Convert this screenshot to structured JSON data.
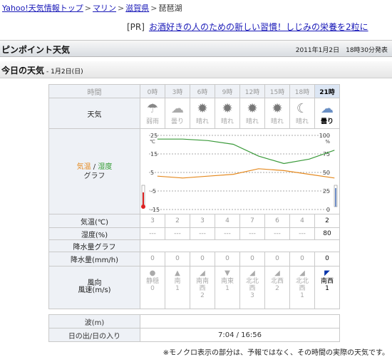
{
  "breadcrumb": {
    "items": [
      "Yahoo!天気情報トップ",
      "マリン",
      "滋賀県"
    ],
    "current": "琵琶湖",
    "separator": ">"
  },
  "ad": {
    "tag": "[PR]",
    "text": "お酒好きの人のための新しい習慣！しじみの栄養を2粒に"
  },
  "header": {
    "title": "ピンポイント天気",
    "published": "2011年1月2日　18時30分発表"
  },
  "today": {
    "title": "今日の天気",
    "date": "- 1月2日(日)"
  },
  "table": {
    "label_time": "時間",
    "label_weather": "天気",
    "label_graph_temp": "気温",
    "label_graph_sep": " / ",
    "label_graph_hum": "湿度",
    "label_graph_word": "グラフ",
    "label_temp": "気温(℃)",
    "label_humidity": "湿度(%)",
    "label_precip_graph": "降水量グラフ",
    "label_precip": "降水量(mm/h)",
    "label_wind_1": "風向",
    "label_wind_2": "風速(m/s)",
    "columns": [
      {
        "hour": "0時",
        "weather": "弱雨",
        "icon": "umbrella-icon",
        "temp": "3",
        "humidity": "---",
        "precip": "0",
        "wind_arrow": "●",
        "wind_dir": "静穏",
        "wind_speed": "0"
      },
      {
        "hour": "3時",
        "weather": "曇り",
        "icon": "cloud-icon",
        "temp": "2",
        "humidity": "---",
        "precip": "0",
        "wind_arrow": "▲",
        "wind_dir": "南",
        "wind_speed": "1"
      },
      {
        "hour": "6時",
        "weather": "晴れ",
        "icon": "sun-icon",
        "temp": "3",
        "humidity": "---",
        "precip": "0",
        "wind_arrow": "◢",
        "wind_dir": "南南西",
        "wind_speed": "2"
      },
      {
        "hour": "9時",
        "weather": "晴れ",
        "icon": "sun-icon",
        "temp": "4",
        "humidity": "---",
        "precip": "0",
        "wind_arrow": "▼",
        "wind_dir": "南東",
        "wind_speed": "1"
      },
      {
        "hour": "12時",
        "weather": "晴れ",
        "icon": "sun-icon",
        "temp": "7",
        "humidity": "---",
        "precip": "0",
        "wind_arrow": "◢",
        "wind_dir": "北北西",
        "wind_speed": "3"
      },
      {
        "hour": "15時",
        "weather": "晴れ",
        "icon": "sun-icon",
        "temp": "6",
        "humidity": "---",
        "precip": "0",
        "wind_arrow": "◢",
        "wind_dir": "北西",
        "wind_speed": "2"
      },
      {
        "hour": "18時",
        "weather": "晴れ",
        "icon": "moon-icon",
        "temp": "4",
        "humidity": "---",
        "precip": "0",
        "wind_arrow": "◢",
        "wind_dir": "北北西",
        "wind_speed": "1"
      },
      {
        "hour": "21時",
        "weather": "曇り",
        "icon": "cloud-icon",
        "temp": "2",
        "humidity": "80",
        "precip": "0",
        "wind_arrow": "◤",
        "wind_dir": "南西",
        "wind_speed": "1"
      }
    ]
  },
  "graph": {
    "left_ticks": [
      "25",
      "15",
      "5",
      "-5",
      "-15"
    ],
    "right_ticks": [
      "100",
      "75",
      "50",
      "25",
      "0"
    ],
    "left_unit": "℃",
    "right_unit": "%",
    "temp_series": [
      3,
      2,
      3,
      4,
      7,
      6,
      4,
      2
    ],
    "humidity_series": [
      95,
      95,
      93,
      88,
      72,
      62,
      68,
      80
    ]
  },
  "extras": {
    "wave_label": "波(m)",
    "wave_value": "",
    "sun_label": "日の出/日の入り",
    "sun_value": "7:04 / 16:56"
  },
  "footnote": "※モノクロ表示の部分は、予報ではなく、その時間の実際の天気です。",
  "colors": {
    "temp_line": "#e58a20",
    "humidity_line": "#3a9a3a",
    "current_col": "#dce6f4"
  }
}
